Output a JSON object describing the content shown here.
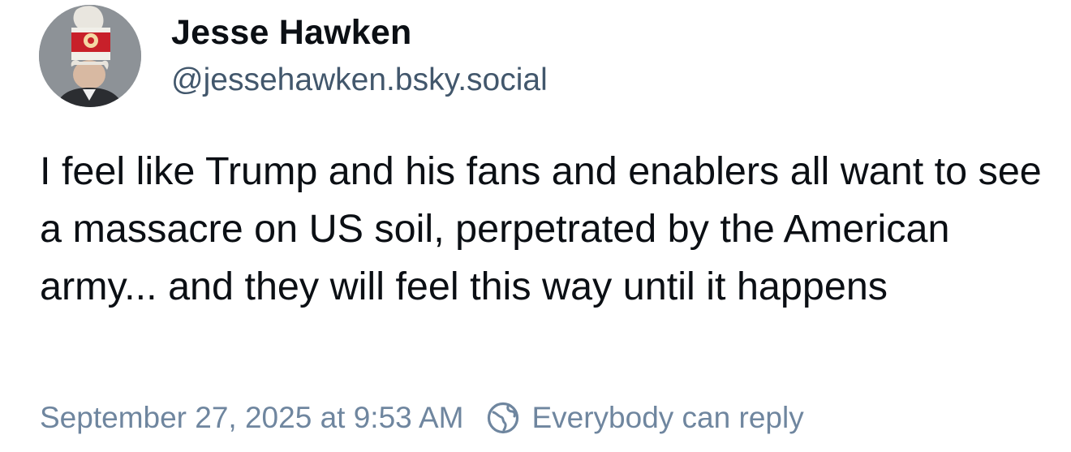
{
  "author": {
    "display_name": "Jesse Hawken",
    "handle": "@jessehawken.bsky.social",
    "avatar_icon": "avatar-image"
  },
  "post": {
    "text": "I feel like Trump and his fans and enablers all want to see a massacre on US soil, perpetrated by the American army... and they will feel this way until it happens"
  },
  "meta": {
    "timestamp": "September 27, 2025 at 9:53 AM",
    "reply_setting": "Everybody can reply",
    "reply_icon": "globe-icon"
  },
  "colors": {
    "text": "#0b0f14",
    "handle": "#42576c",
    "meta": "#6f869f"
  }
}
